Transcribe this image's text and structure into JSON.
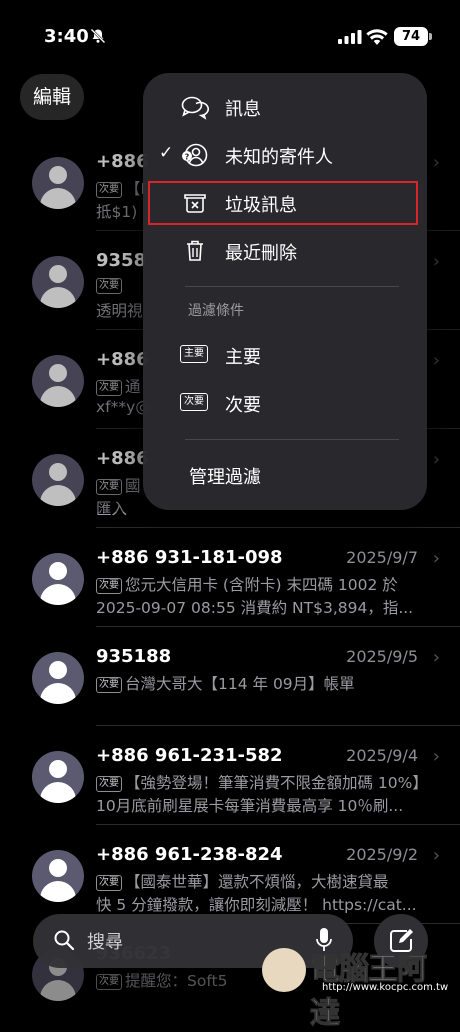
{
  "status": {
    "time": "3:40",
    "battery": "74"
  },
  "header": {
    "edit_label": "編輯"
  },
  "conversations": [
    {
      "name": "+886",
      "date": "",
      "line1": "【P",
      "badge": "次要",
      "line2": "抵$1)"
    },
    {
      "name": "9358",
      "date": "",
      "line1": "",
      "badge": "次要",
      "line2": "透明視"
    },
    {
      "name": "+886",
      "date": "",
      "line1": "通",
      "badge": "次要",
      "line2": "xf**y@"
    },
    {
      "name": "+886",
      "date": "",
      "line1": "國",
      "badge": "次要",
      "line2": "匯入"
    },
    {
      "name": "+886 931-181-098",
      "date": "2025/9/7",
      "badge": "次要",
      "line1": "您元大信用卡 (含附卡) 末四碼 1002 於",
      "line2": "2025-09-07 08:55 消費約 NT$3,894，指..."
    },
    {
      "name": "935188",
      "date": "2025/9/5",
      "badge": "次要",
      "line1": "台灣大哥大【114 年 09月】帳單",
      "line2": ""
    },
    {
      "name": "+886 961-231-582",
      "date": "2025/9/4",
      "badge": "次要",
      "line1": "【強勢登場！筆筆消費不限金額加碼 10%】",
      "line2": "10月底前刷星展卡每筆消費最高享 10％刷..."
    },
    {
      "name": "+886 961-238-824",
      "date": "2025/9/2",
      "badge": "次要",
      "line1": "【國泰世華】還款不煩惱，大樹速貸最",
      "line2": "快 5 分鐘撥款，讓你即刻減壓！ https://cat..."
    },
    {
      "name": "936623",
      "date": "",
      "badge": "次要",
      "line1": "提醒您：Soft5",
      "line2": ""
    }
  ],
  "menu": {
    "items": [
      {
        "label": "訊息",
        "icon": "messages-icon"
      },
      {
        "label": "未知的寄件人",
        "icon": "unknown-sender-icon",
        "checked": true
      },
      {
        "label": "垃圾訊息",
        "icon": "junk-icon"
      },
      {
        "label": "最近刪除",
        "icon": "trash-icon"
      }
    ],
    "section_title": "過濾條件",
    "filters": [
      {
        "label": "主要",
        "tag": "主要"
      },
      {
        "label": "次要",
        "tag": "次要"
      }
    ],
    "manage_label": "管理過濾"
  },
  "bottom": {
    "search_placeholder": "搜尋"
  },
  "watermark": {
    "text": "電腦王阿達",
    "url": "http://www.kocpc.com.tw"
  }
}
